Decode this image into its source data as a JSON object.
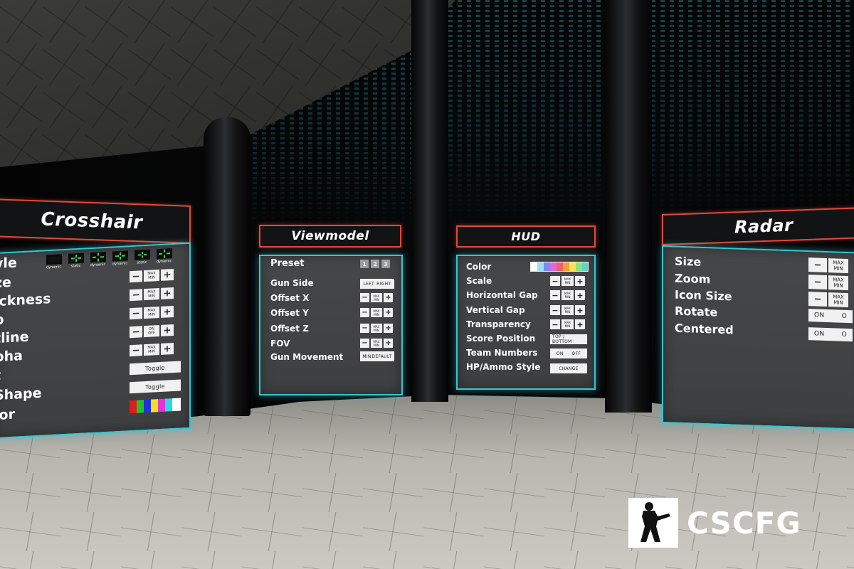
{
  "crosshair": {
    "title": "Crosshair",
    "rows": [
      "yle",
      "ze",
      "ickness",
      "p",
      "tline",
      "pha",
      "t",
      "Shape",
      "lor"
    ],
    "styles": [
      "dynamic",
      "static",
      "dynamic",
      "dynamic",
      "static",
      "dynamic"
    ],
    "minus": "−",
    "plus": "+",
    "maxmin": [
      "MAX",
      "MIN"
    ],
    "onoff": [
      "ON",
      "OFF"
    ],
    "toggle": "Toggle",
    "colors": [
      "#e21b1b",
      "#26c12a",
      "#2230e0",
      "#f2e21c",
      "#e234d6",
      "#2cd8e0",
      "#ffffff"
    ]
  },
  "viewmodel": {
    "title": "Viewmodel",
    "preset_label": "Preset",
    "presets": [
      "1",
      "2",
      "3"
    ],
    "rows": [
      "Gun Side",
      "Offset X",
      "Offset Y",
      "Offset Z",
      "FOV",
      "Gun Movement"
    ],
    "gun_side": [
      "LEFT",
      "RIGHT"
    ],
    "gun_movement": [
      "MIN",
      "DEFAULT"
    ]
  },
  "hud": {
    "title": "HUD",
    "rows": [
      "Color",
      "Scale",
      "Horizontal Gap",
      "Vertical Gap",
      "Transparency",
      "Score Position",
      "Team Numbers",
      "HP/Ammo Style"
    ],
    "score_position": "TOP / BOTTOM",
    "team_numbers": [
      "ON",
      "OFF"
    ],
    "hp_style": "CHANGE",
    "colors": [
      "#ffffff",
      "#9fdcf2",
      "#7b8cf0",
      "#d86be0",
      "#f0606a",
      "#f2a23c",
      "#f5e35a",
      "#8fe27c",
      "#5bd7c9"
    ]
  },
  "radar": {
    "title": "Radar",
    "rows": [
      "Size",
      "Zoom",
      "Icon Size",
      "Rotate",
      "Centered"
    ],
    "on": "ON",
    "off_partial": "O"
  },
  "logo": {
    "text": "CSCFG",
    "icon": "soldier-silhouette-icon"
  },
  "accents": {
    "title_border": "#e0493c",
    "panel_border": "#38c5cf"
  }
}
